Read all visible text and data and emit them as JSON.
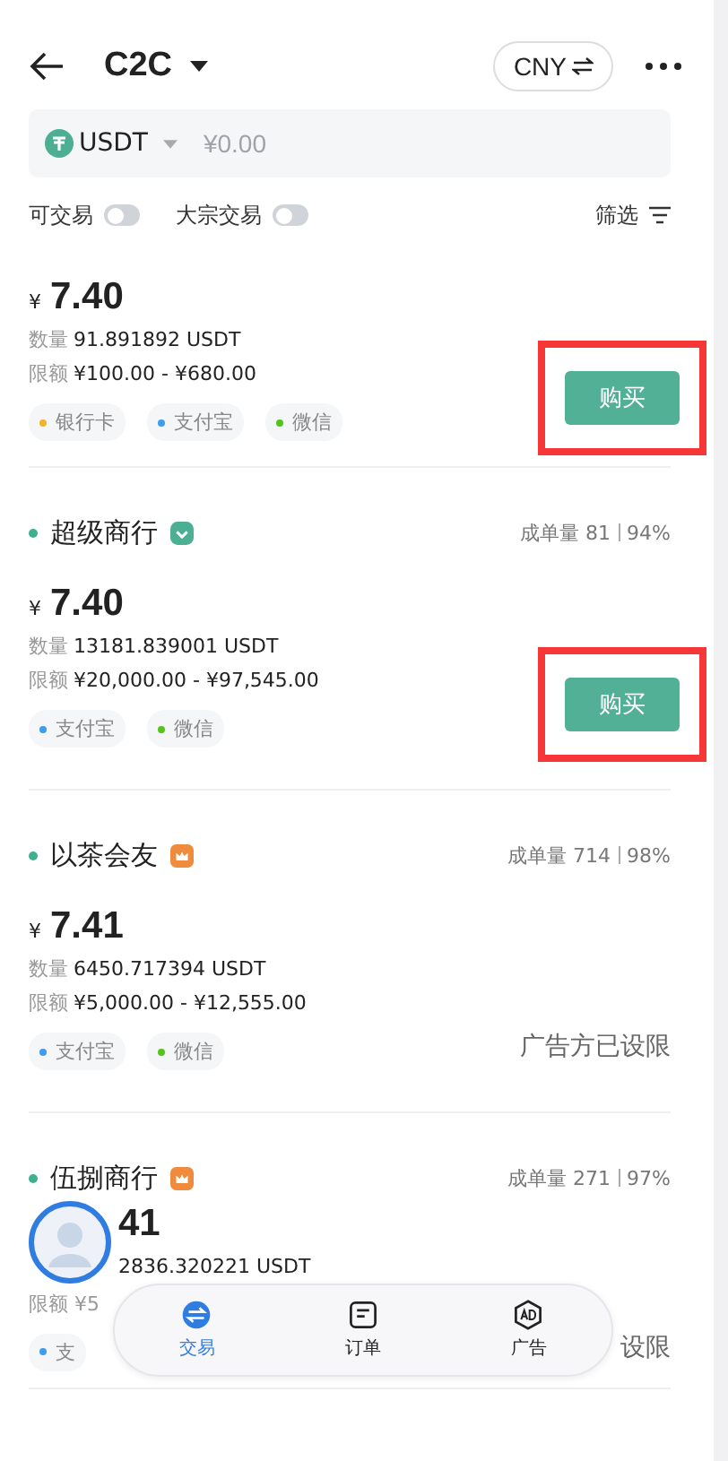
{
  "header": {
    "title": "C2C",
    "currency": "CNY"
  },
  "search": {
    "coin": "USDT",
    "placeholder": "¥0.00"
  },
  "filters": {
    "toggles": [
      {
        "label": "可交易",
        "on": false
      },
      {
        "label": "大宗交易",
        "on": false
      }
    ],
    "filter_label": "筛选"
  },
  "offers": [
    {
      "price_symbol": "¥",
      "price": "7.40",
      "quantity_label": "数量",
      "quantity": "91.891892 USDT",
      "limit_label": "限额",
      "limit": "¥100.00 - ¥680.00",
      "payments": [
        {
          "label": "银行卡",
          "color": "#f0b429"
        },
        {
          "label": "支付宝",
          "color": "#3b9cf0"
        },
        {
          "label": "微信",
          "color": "#52c41a"
        }
      ],
      "action": {
        "kind": "buy",
        "label": "购买",
        "highlighted": true
      }
    },
    {
      "merchant": {
        "name": "超级商行",
        "badge": {
          "kind": "shield"
        },
        "orders": "成单量 81",
        "rate": "94%"
      },
      "price_symbol": "¥",
      "price": "7.40",
      "quantity_label": "数量",
      "quantity": "13181.839001 USDT",
      "limit_label": "限额",
      "limit": "¥20,000.00 - ¥97,545.00",
      "payments": [
        {
          "label": "支付宝",
          "color": "#3b9cf0"
        },
        {
          "label": "微信",
          "color": "#52c41a"
        }
      ],
      "action": {
        "kind": "buy",
        "label": "购买",
        "highlighted": true
      }
    },
    {
      "merchant": {
        "name": "以茶会友",
        "badge": {
          "kind": "crown"
        },
        "orders": "成单量 714",
        "rate": "98%"
      },
      "price_symbol": "¥",
      "price": "7.41",
      "quantity_label": "数量",
      "quantity": "6450.717394 USDT",
      "limit_label": "限额",
      "limit": "¥5,000.00 - ¥12,555.00",
      "payments": [
        {
          "label": "支付宝",
          "color": "#3b9cf0"
        },
        {
          "label": "微信",
          "color": "#52c41a"
        }
      ],
      "action": {
        "kind": "restricted",
        "label": "广告方已设限"
      }
    }
  ],
  "last_offer": {
    "name": "伍捌商行",
    "badge": {
      "kind": "crown"
    },
    "orders": "成单量 271",
    "rate": "97%",
    "price_part": "41",
    "quantity_part": "2836.320221 USDT",
    "limit_part": "限额 ¥5",
    "payment_part": {
      "label": "支",
      "color": "#3b9cf0"
    },
    "action_part": "设限"
  },
  "nav": [
    {
      "label": "交易",
      "kind": "swap",
      "selected": true
    },
    {
      "label": "订单",
      "kind": "order",
      "selected": false
    },
    {
      "label": "广告",
      "kind": "ad",
      "selected": false
    }
  ]
}
